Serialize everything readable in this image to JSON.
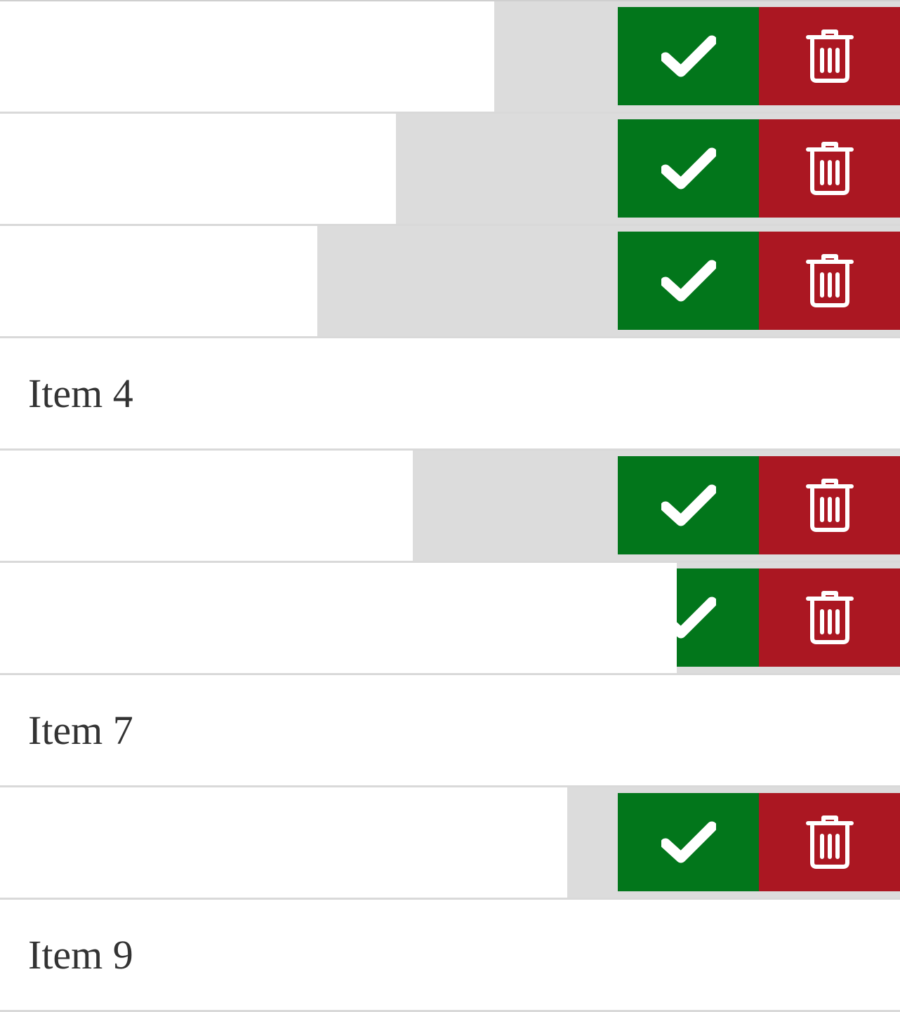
{
  "colors": {
    "done_button": "#02761b",
    "delete_button": "#ab1722",
    "revealed_background": "#dcdcdc",
    "row_background": "#ffffff",
    "divider": "#d9d9d9",
    "text": "#333333"
  },
  "icons": {
    "done": "checkmark-icon",
    "delete": "trash-icon"
  },
  "items": [
    {
      "label": "",
      "swiped": true
    },
    {
      "label": "",
      "swiped": true
    },
    {
      "label": "",
      "swiped": true
    },
    {
      "label": "Item 4",
      "swiped": false
    },
    {
      "label": "",
      "swiped": true
    },
    {
      "label": "",
      "swiped": true
    },
    {
      "label": "Item 7",
      "swiped": false
    },
    {
      "label": "",
      "swiped": true
    },
    {
      "label": "Item 9",
      "swiped": false
    }
  ]
}
